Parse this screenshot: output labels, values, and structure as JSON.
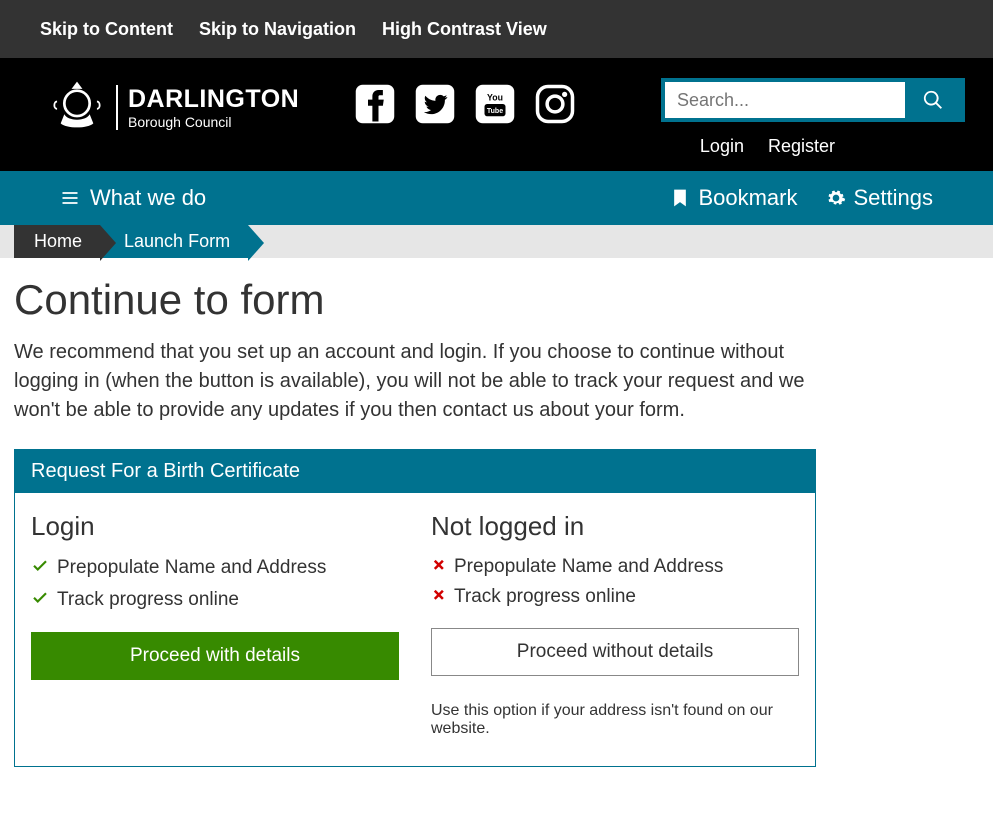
{
  "utility": {
    "skip_content": "Skip to Content",
    "skip_nav": "Skip to Navigation",
    "high_contrast": "High Contrast View"
  },
  "logo": {
    "main": "DARLINGTON",
    "sub": "Borough Council"
  },
  "search": {
    "placeholder": "Search..."
  },
  "auth": {
    "login": "Login",
    "register": "Register"
  },
  "nav": {
    "what_we_do": "What we do",
    "bookmark": "Bookmark",
    "settings": "Settings"
  },
  "breadcrumb": {
    "home": "Home",
    "launch": "Launch Form"
  },
  "page_title": "Continue to form",
  "intro": "We recommend that you set up an account and login. If you choose to continue without logging in (when the button is available), you will not be able to track your request and we won't be able to provide any updates if you then contact us about your form.",
  "panel": {
    "heading": "Request For a Birth Certificate",
    "left": {
      "title": "Login",
      "item1": "Prepopulate Name and Address",
      "item2": "Track progress online",
      "button": "Proceed with details"
    },
    "right": {
      "title": "Not logged in",
      "item1": "Prepopulate Name and Address",
      "item2": "Track progress online",
      "button": "Proceed without details",
      "hint": "Use this option if your address isn't found on our website."
    }
  }
}
